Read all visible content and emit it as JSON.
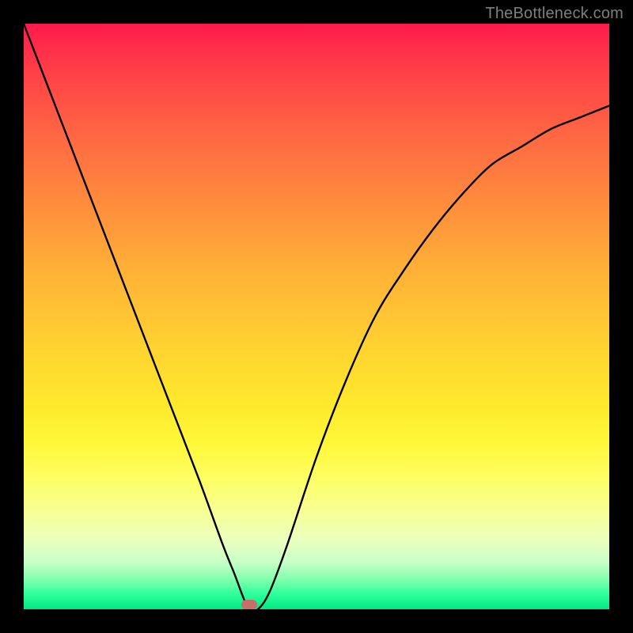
{
  "watermark": "TheBottleneck.com",
  "marker": {
    "x_frac": 0.385,
    "y_frac": 0.992
  },
  "chart_data": {
    "type": "line",
    "title": "",
    "xlabel": "",
    "ylabel": "",
    "xlim": [
      0,
      1
    ],
    "ylim": [
      0,
      1
    ],
    "series": [
      {
        "name": "bottleneck-curve",
        "x": [
          0.0,
          0.05,
          0.1,
          0.15,
          0.2,
          0.25,
          0.3,
          0.34,
          0.36,
          0.375,
          0.385,
          0.4,
          0.42,
          0.45,
          0.5,
          0.55,
          0.6,
          0.65,
          0.7,
          0.75,
          0.8,
          0.85,
          0.9,
          0.95,
          1.0
        ],
        "y": [
          1.0,
          0.87,
          0.74,
          0.61,
          0.48,
          0.35,
          0.22,
          0.11,
          0.06,
          0.02,
          0.0,
          0.0,
          0.03,
          0.11,
          0.26,
          0.39,
          0.5,
          0.58,
          0.65,
          0.71,
          0.76,
          0.79,
          0.82,
          0.84,
          0.86
        ]
      }
    ],
    "gradient_stops": [
      {
        "pos": 0.0,
        "color": "#ff1a4b"
      },
      {
        "pos": 0.2,
        "color": "#ff6a42"
      },
      {
        "pos": 0.55,
        "color": "#ffd230"
      },
      {
        "pos": 0.78,
        "color": "#fdff66"
      },
      {
        "pos": 0.92,
        "color": "#c7ffc8"
      },
      {
        "pos": 1.0,
        "color": "#00e885"
      }
    ]
  }
}
